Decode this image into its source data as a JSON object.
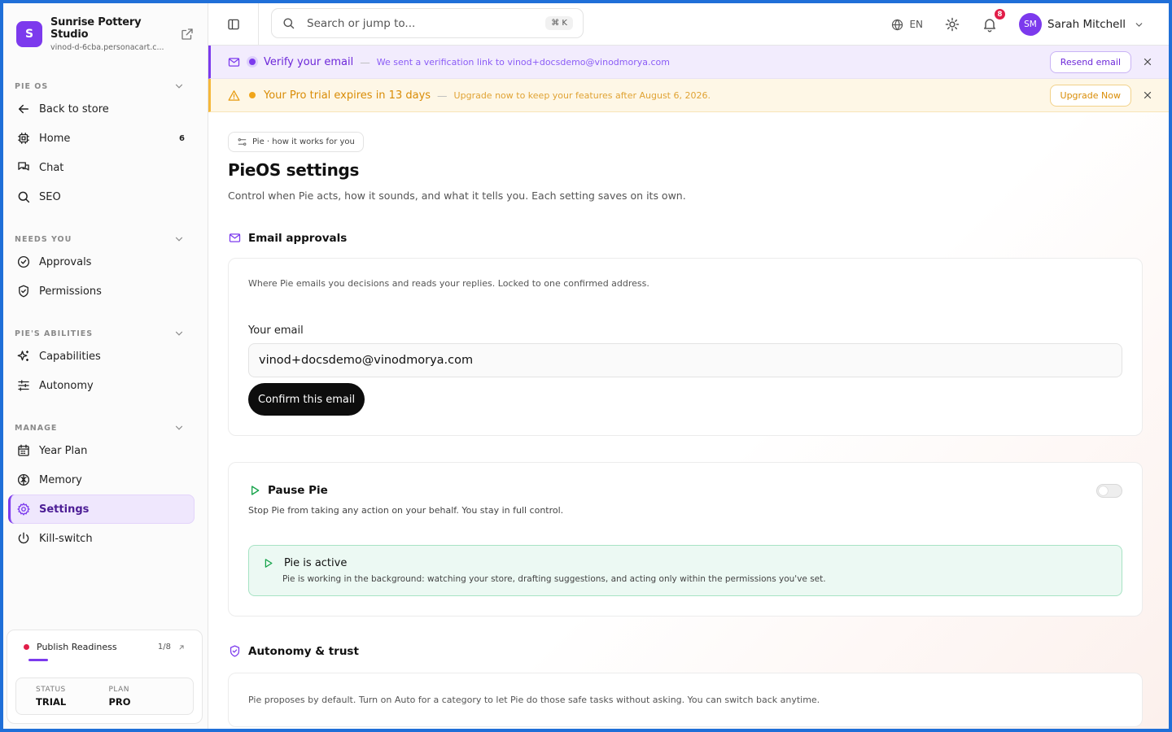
{
  "brand": {
    "initial": "S",
    "name": "Sunrise Pottery Studio",
    "domain": "vinod-d-6cba.personacart.c..."
  },
  "sidebar": {
    "sections": [
      {
        "title": "PIE OS",
        "items": [
          {
            "label": "Back to store",
            "icon": "arrow-left-icon"
          },
          {
            "label": "Home",
            "icon": "chip-icon",
            "count": "6"
          },
          {
            "label": "Chat",
            "icon": "chat-icon"
          },
          {
            "label": "SEO",
            "icon": "search-icon"
          }
        ]
      },
      {
        "title": "NEEDS YOU",
        "items": [
          {
            "label": "Approvals",
            "icon": "check-circle-icon"
          },
          {
            "label": "Permissions",
            "icon": "shield-check-icon"
          }
        ]
      },
      {
        "title": "PIE'S ABILITIES",
        "items": [
          {
            "label": "Capabilities",
            "icon": "sparkle-icon"
          },
          {
            "label": "Autonomy",
            "icon": "sliders-icon"
          }
        ]
      },
      {
        "title": "MANAGE",
        "items": [
          {
            "label": "Year Plan",
            "icon": "calendar-icon"
          },
          {
            "label": "Memory",
            "icon": "brain-icon"
          },
          {
            "label": "Settings",
            "icon": "gear-icon",
            "active": true
          },
          {
            "label": "Kill-switch",
            "icon": "power-icon"
          }
        ]
      }
    ],
    "readiness": {
      "label": "Publish Readiness",
      "count": "1/8",
      "progress": 0.125
    },
    "status": {
      "key": "STATUS",
      "value": "TRIAL"
    },
    "plan": {
      "key": "PLAN",
      "value": "PRO"
    }
  },
  "topbar": {
    "search_placeholder": "Search or jump to...",
    "shortcut": "⌘ K",
    "lang": "EN",
    "notifications": "8",
    "user_initials": "SM",
    "user_name": "Sarah Mitchell"
  },
  "banners": {
    "verify": {
      "title": "Verify your email",
      "sep": "—",
      "sub": "We sent a verification link to vinod+docsdemo@vinodmorya.com",
      "button": "Resend email"
    },
    "trial": {
      "title": "Your Pro trial expires in 13 days",
      "sep": "—",
      "sub": "Upgrade now to keep your features after August 6, 2026.",
      "button": "Upgrade Now"
    }
  },
  "page": {
    "pill": "Pie · how it works for you",
    "title": "PieOS settings",
    "subtitle": "Control when Pie acts, how it sounds, and what it tells you. Each setting saves on its own."
  },
  "email_approvals": {
    "heading": "Email approvals",
    "desc": "Where Pie emails you decisions and reads your replies. Locked to one confirmed address.",
    "field_label": "Your email",
    "field_value": "vinod+docsdemo@vinodmorya.com",
    "button": "Confirm this email"
  },
  "pause": {
    "heading": "Pause Pie",
    "desc": "Stop Pie from taking any action on your behalf. You stay in full control.",
    "toggle_on": false,
    "active_title": "Pie is active",
    "active_desc": "Pie is working in the background: watching your store, drafting suggestions, and acting only within the permissions you've set."
  },
  "autonomy": {
    "heading": "Autonomy & trust",
    "desc": "Pie proposes by default. Turn on Auto for a category to let Pie do those safe tasks without asking. You can switch back anytime."
  },
  "colors": {
    "accent": "#7c3aed",
    "frame": "#1f6fd8",
    "success": "#16a34a",
    "warning": "#f0a51a",
    "danger": "#e11d48"
  }
}
